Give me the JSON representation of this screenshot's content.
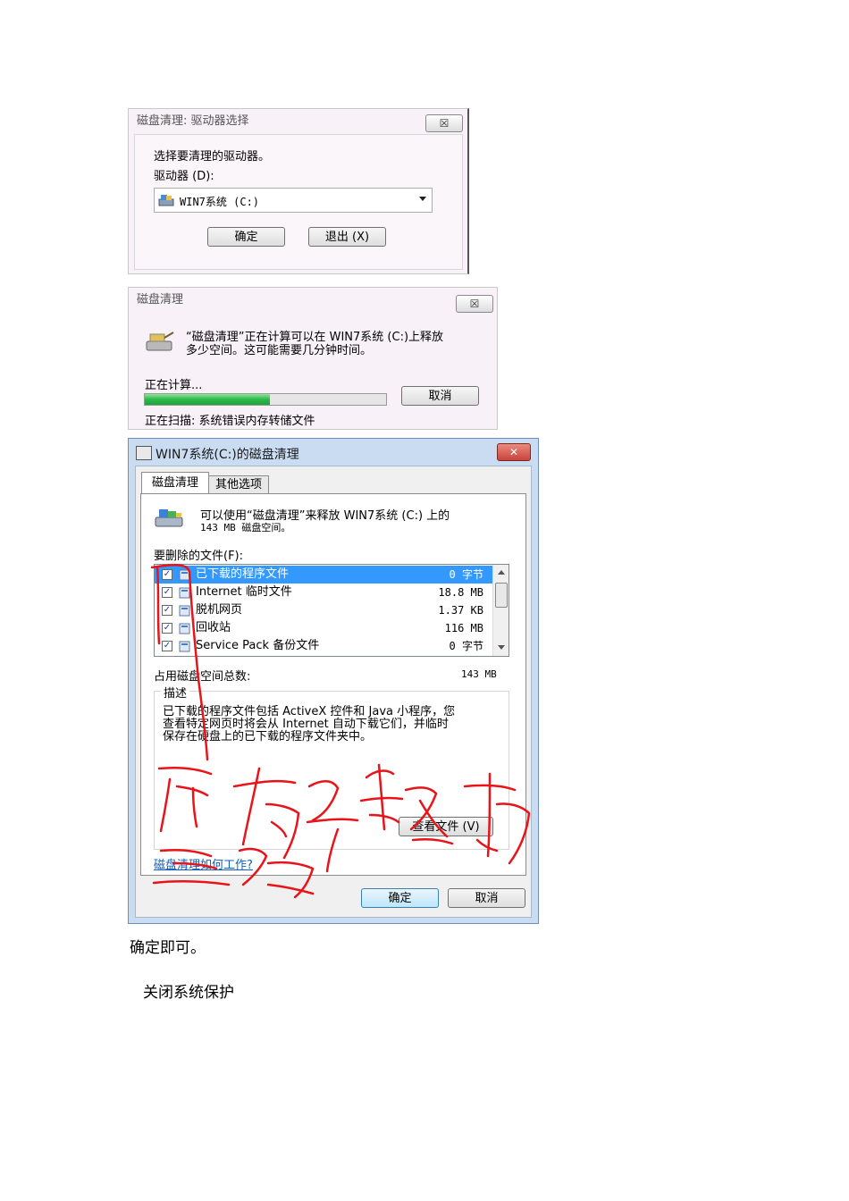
{
  "dialog1": {
    "title": "磁盘清理: 驱动器选择",
    "close": "☒",
    "prompt": "选择要清理的驱动器。",
    "drive_label": "驱动器 (D):",
    "drive_value": "WIN7系统 (C:)",
    "ok": "确定",
    "exit": "退出 (X)"
  },
  "dialog2": {
    "title": "磁盘清理",
    "close": "☒",
    "message_line1": "“磁盘清理”正在计算可以在 WIN7系统 (C:)上释放",
    "message_line2": "多少空间。这可能需要几分钟时间。",
    "calculating": "正在计算...",
    "progress": 0.52,
    "cancel": "取消",
    "scanning": "正在扫描:  系统错误内存转储文件"
  },
  "dialog3": {
    "title": "WIN7系统(C:)的磁盘清理",
    "close": "✕",
    "tabs": [
      "磁盘清理",
      "其他选项"
    ],
    "intro_line1": "可以使用“磁盘清理”来释放 WIN7系统 (C:) 上的",
    "intro_line2": "143 MB 磁盘空间。",
    "files_label": "要删除的文件(F):",
    "files": [
      {
        "name": "已下载的程序文件",
        "size": "0 字节",
        "checked": true,
        "selected": true,
        "icon": "folder-icon"
      },
      {
        "name": "Internet 临时文件",
        "size": "18.8 MB",
        "checked": true,
        "selected": false,
        "icon": "document-icon"
      },
      {
        "name": "脱机网页",
        "size": "1.37 KB",
        "checked": true,
        "selected": false,
        "icon": "offline-page-icon"
      },
      {
        "name": "回收站",
        "size": "116 MB",
        "checked": true,
        "selected": false,
        "icon": "recycle-bin-icon"
      },
      {
        "name": "Service Pack 备份文件",
        "size": "0 字节",
        "checked": true,
        "selected": false,
        "icon": "backup-icon"
      }
    ],
    "total_label": "占用磁盘空间总数:",
    "total_value": "143 MB",
    "desc_legend": "描述",
    "desc_line1": "已下载的程序文件包括 ActiveX 控件和 Java 小程序，您",
    "desc_line2": "查看特定网页时将会从 Internet 自动下载它们，并临时",
    "desc_line3": "保存在硬盘上的已下载的程序文件夹中。",
    "view_files": "查看文件 (V)",
    "help_link": "磁盘清理如何工作?",
    "ok": "确定",
    "cancel": "取消"
  },
  "doc": {
    "line1": "确定即可。",
    "line2": "关闭系统保护"
  },
  "colors": {
    "dialog_bg": "#f8f1f7",
    "selection": "#3399ff",
    "progress_green": "#2db84a",
    "close_red": "#c8453a",
    "annotation_red": "#e8141a"
  }
}
